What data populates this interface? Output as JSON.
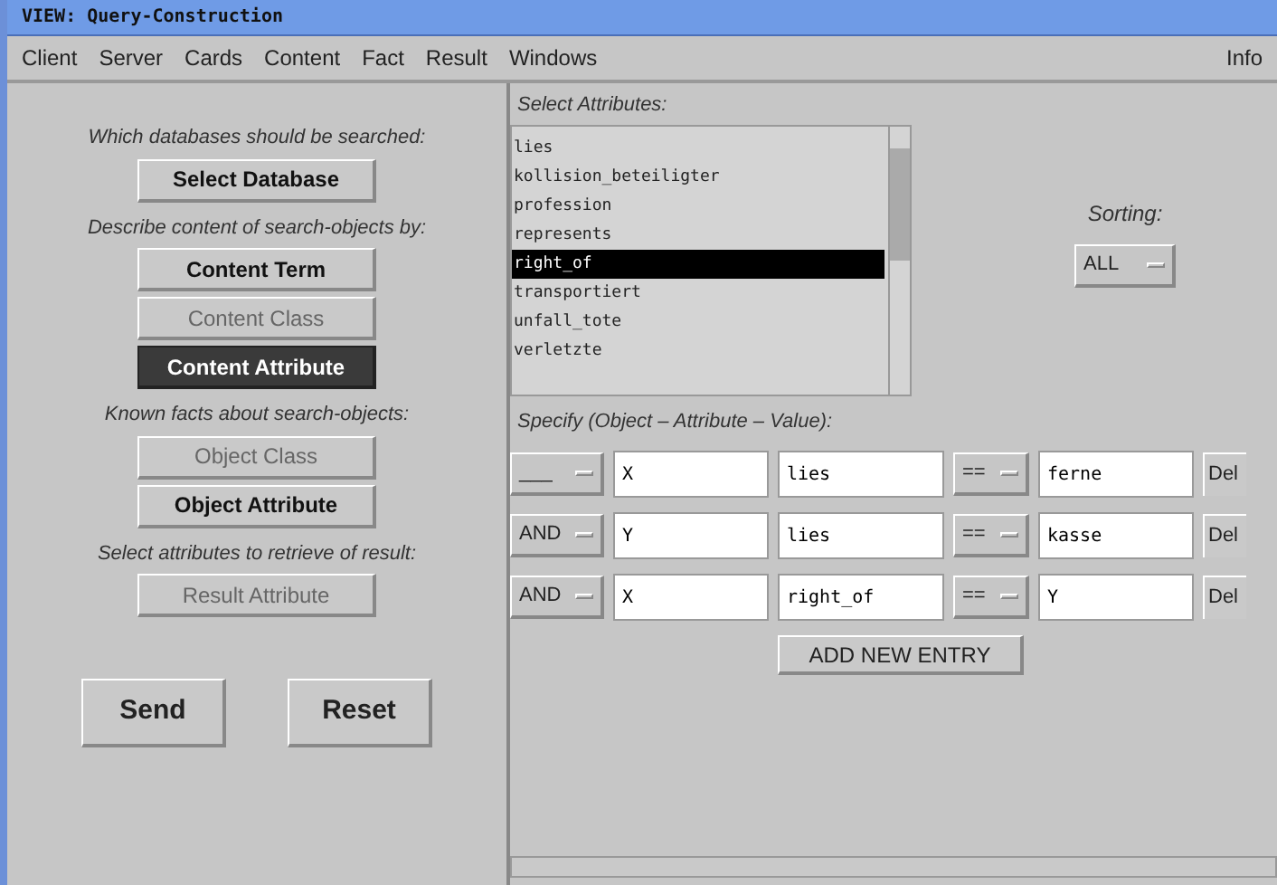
{
  "window": {
    "title": "VIEW: Query-Construction"
  },
  "menu": [
    "Client",
    "Server",
    "Cards",
    "Content",
    "Fact",
    "Result",
    "Windows"
  ],
  "menu_right": "Info",
  "left_panel": {
    "sections": [
      {
        "prompt": "Which databases should be searched:",
        "buttons": [
          {
            "label": "Select Database",
            "disabled": false,
            "selected": false
          }
        ]
      },
      {
        "prompt": "Describe content of search-objects by:",
        "buttons": [
          {
            "label": "Content Term",
            "disabled": false,
            "selected": false
          },
          {
            "label": "Content Class",
            "disabled": true,
            "selected": false
          },
          {
            "label": "Content Attribute",
            "disabled": false,
            "selected": true
          }
        ]
      },
      {
        "prompt": "Known facts about search-objects:",
        "buttons": [
          {
            "label": "Object Class",
            "disabled": true,
            "selected": false
          },
          {
            "label": "Object Attribute",
            "disabled": false,
            "selected": false
          }
        ]
      },
      {
        "prompt": "Select attributes to retrieve of result:",
        "buttons": [
          {
            "label": "Result Attribute",
            "disabled": true,
            "selected": false
          }
        ]
      }
    ],
    "actions": [
      "Send",
      "Reset"
    ]
  },
  "attributes": {
    "label": "Select Attributes:",
    "items": [
      {
        "text": "lies",
        "selected": false
      },
      {
        "text": "kollision_beteiligter",
        "selected": false
      },
      {
        "text": "profession",
        "selected": false
      },
      {
        "text": "represents",
        "selected": false
      },
      {
        "text": "right_of",
        "selected": true
      },
      {
        "text": "transportiert",
        "selected": false
      },
      {
        "text": "unfall_tote",
        "selected": false
      },
      {
        "text": "verletzte",
        "selected": false
      }
    ]
  },
  "sorting": {
    "label": "Sorting:",
    "value": "ALL"
  },
  "specify": {
    "label": "Specify (Object – Attribute – Value):",
    "rows": [
      {
        "connector": "___",
        "object": "X",
        "attribute": "lies",
        "operator": "==",
        "value": "ferne",
        "delete": "Del"
      },
      {
        "connector": "AND",
        "object": "Y",
        "attribute": "lies",
        "operator": "==",
        "value": "kasse",
        "delete": "Del"
      },
      {
        "connector": "AND",
        "object": "X",
        "attribute": "right_of",
        "operator": "==",
        "value": "Y",
        "delete": "Del"
      }
    ],
    "add_button": "ADD NEW ENTRY"
  }
}
